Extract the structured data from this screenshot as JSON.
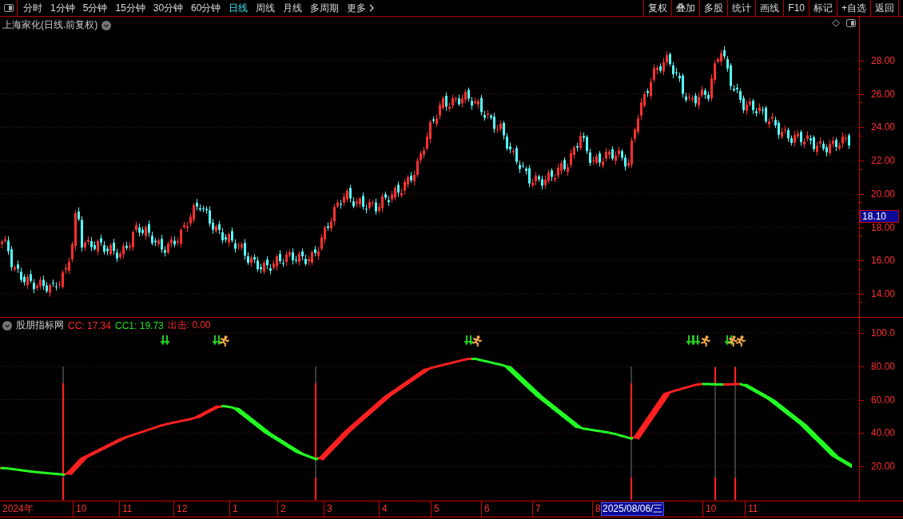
{
  "toolbar": {
    "periods": [
      {
        "label": "分时",
        "selected": false,
        "kind": "period"
      },
      {
        "label": "1分钟",
        "selected": false,
        "kind": "period"
      },
      {
        "label": "5分钟",
        "selected": false,
        "kind": "period"
      },
      {
        "label": "15分钟",
        "selected": false,
        "kind": "period"
      },
      {
        "label": "30分钟",
        "selected": false,
        "kind": "period"
      },
      {
        "label": "60分钟",
        "selected": false,
        "kind": "period"
      },
      {
        "label": "日线",
        "selected": true,
        "kind": "period"
      },
      {
        "label": "周线",
        "selected": false,
        "kind": "period"
      },
      {
        "label": "月线",
        "selected": false,
        "kind": "period"
      },
      {
        "label": "多周期",
        "selected": false,
        "kind": "period"
      },
      {
        "label": "更多",
        "selected": false,
        "kind": "menu"
      }
    ],
    "actions": [
      "复权",
      "叠加",
      "多股",
      "统计",
      "画线",
      "F10",
      "标记",
      "+自选",
      "返回"
    ]
  },
  "main_chart": {
    "title": "上海家化(日线.前复权)",
    "price_axis": [
      "28.00",
      "26.00",
      "24.00",
      "22.00",
      "20.00",
      "18.00",
      "16.00",
      "14.00"
    ],
    "last_price": "18.10"
  },
  "indicator": {
    "name": "股朋指标网",
    "readings": [
      {
        "label": "CC: 17.34",
        "color": "#ff2a2a"
      },
      {
        "label": "CC1: 19.73",
        "color": "#22e022"
      },
      {
        "label": "出击: 0.00",
        "color": "#ff2a2a"
      }
    ],
    "axis": [
      "100.0",
      "80.00",
      "60.00",
      "40.00",
      "20.00"
    ]
  },
  "time_axis": [
    {
      "label": "2024年",
      "selected": false
    },
    {
      "label": "10",
      "selected": false
    },
    {
      "label": "11",
      "selected": false
    },
    {
      "label": "12",
      "selected": false
    },
    {
      "label": "1",
      "selected": false
    },
    {
      "label": "2",
      "selected": false
    },
    {
      "label": "3",
      "selected": false
    },
    {
      "label": "4",
      "selected": false
    },
    {
      "label": "5",
      "selected": false
    },
    {
      "label": "6",
      "selected": false
    },
    {
      "label": "7",
      "selected": false
    },
    {
      "label": "8",
      "selected": false
    },
    {
      "label": "2025/08/06/三",
      "selected": true
    },
    {
      "label": "10",
      "selected": false
    },
    {
      "label": "11",
      "selected": false
    }
  ]
}
